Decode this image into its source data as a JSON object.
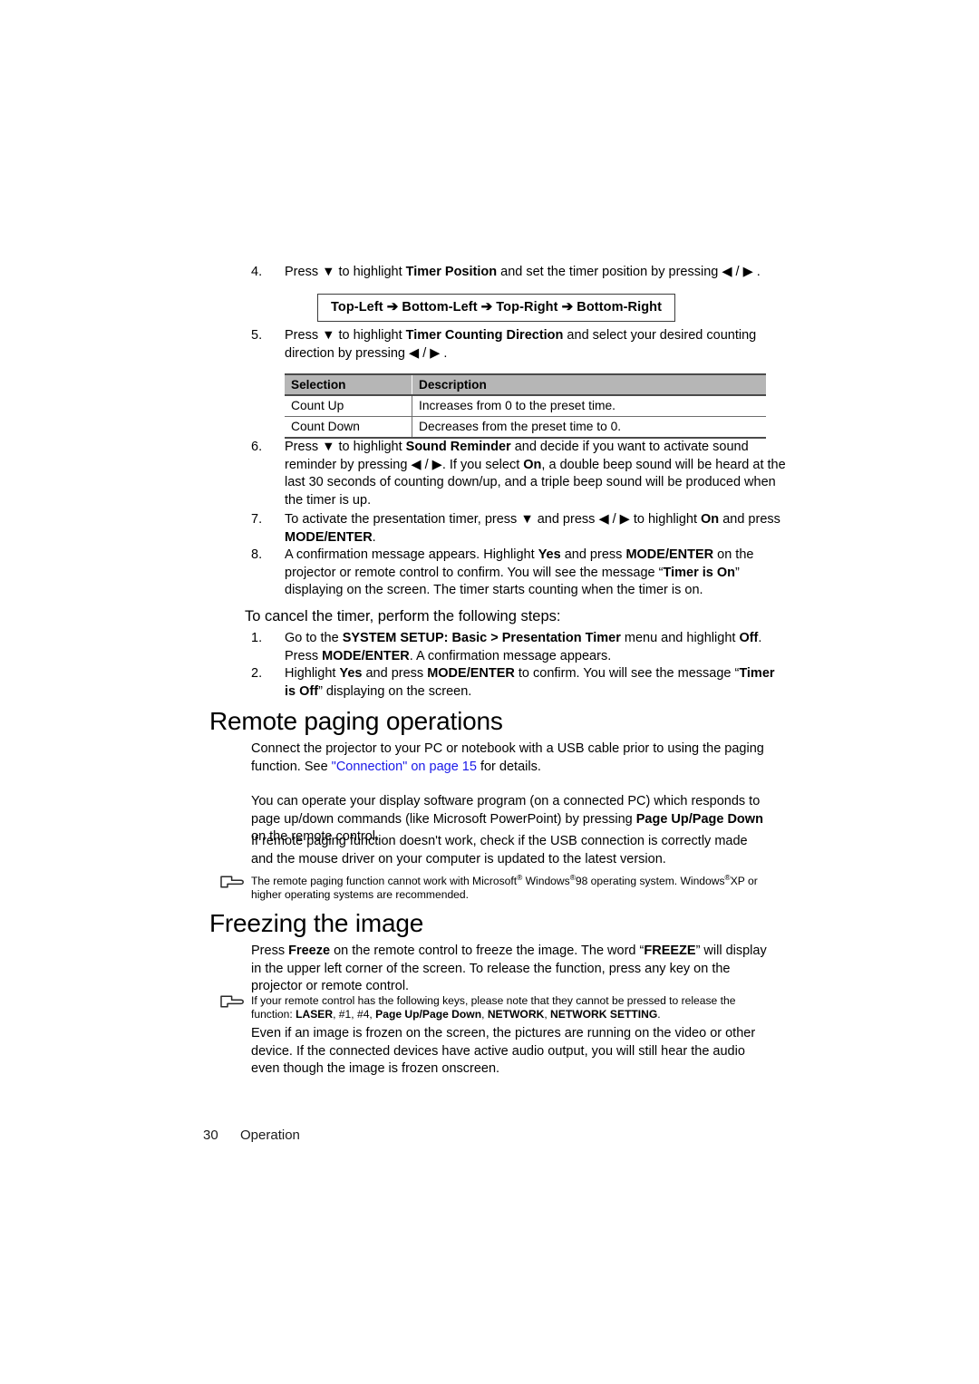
{
  "document": {
    "page_number": "30",
    "footer_label": "Operation",
    "link_color": "#1a19e8",
    "table_header_bg": "#b6b6b6"
  },
  "steps_top": [
    {
      "num": "4.",
      "parts": [
        {
          "t": "Press ",
          "s": "n"
        },
        {
          "t": "▼",
          "s": "n"
        },
        {
          "t": " to highlight ",
          "s": "n"
        },
        {
          "t": "Timer Position",
          "s": "b"
        },
        {
          "t": " and set the timer position by pressing ",
          "s": "n"
        },
        {
          "t": "◀ / ▶",
          "s": "n"
        },
        {
          "t": " .",
          "s": "n"
        }
      ]
    }
  ],
  "position_box": {
    "items": [
      "Top-Left",
      "Bottom-Left",
      "Top-Right",
      "Bottom-Right"
    ],
    "separator": "➔"
  },
  "step5": {
    "num": "5.",
    "parts": [
      {
        "t": "Press ",
        "s": "n"
      },
      {
        "t": "▼",
        "s": "n"
      },
      {
        "t": " to highlight ",
        "s": "n"
      },
      {
        "t": "Timer Counting Direction",
        "s": "b"
      },
      {
        "t": " and select your desired counting direction by pressing ",
        "s": "n"
      },
      {
        "t": "◀ / ▶",
        "s": "n"
      },
      {
        "t": " .",
        "s": "n"
      }
    ]
  },
  "selection_table": {
    "headers": [
      "Selection",
      "Description"
    ],
    "rows": [
      [
        "Count Up",
        "Increases from 0 to the preset time."
      ],
      [
        "Count Down",
        "Decreases from the preset time to 0."
      ]
    ]
  },
  "step6": {
    "num": "6.",
    "parts": [
      {
        "t": "Press ",
        "s": "n"
      },
      {
        "t": "▼",
        "s": "n"
      },
      {
        "t": " to highlight ",
        "s": "n"
      },
      {
        "t": "Sound Reminder",
        "s": "b"
      },
      {
        "t": " and decide if you want to activate sound reminder by pressing ",
        "s": "n"
      },
      {
        "t": "◀ / ▶",
        "s": "n"
      },
      {
        "t": ". If you select ",
        "s": "n"
      },
      {
        "t": "On",
        "s": "b"
      },
      {
        "t": ", a double beep sound will be heard at the last 30 seconds of counting down/up, and a triple beep sound will be produced when the timer is up.",
        "s": "n"
      }
    ]
  },
  "step7": {
    "num": "7.",
    "parts": [
      {
        "t": "To activate the presentation timer, press ",
        "s": "n"
      },
      {
        "t": "▼",
        "s": "n"
      },
      {
        "t": " and press ",
        "s": "n"
      },
      {
        "t": "◀ / ▶",
        "s": "n"
      },
      {
        "t": " to highlight ",
        "s": "n"
      },
      {
        "t": "On",
        "s": "b"
      },
      {
        "t": " and press ",
        "s": "n"
      },
      {
        "t": "MODE/ENTER",
        "s": "b"
      },
      {
        "t": ".",
        "s": "n"
      }
    ]
  },
  "step8": {
    "num": "8.",
    "parts": [
      {
        "t": "A confirmation message appears. Highlight ",
        "s": "n"
      },
      {
        "t": "Yes",
        "s": "b"
      },
      {
        "t": " and press ",
        "s": "n"
      },
      {
        "t": "MODE/ENTER",
        "s": "b"
      },
      {
        "t": " on the projector or remote control to confirm. You will see the message “",
        "s": "n"
      },
      {
        "t": "Timer is On",
        "s": "b"
      },
      {
        "t": "” displaying on the screen. The timer starts counting when the timer is on.",
        "s": "n"
      }
    ]
  },
  "cancel_heading": "To cancel the timer, perform the following steps:",
  "cancel_steps": [
    {
      "num": "1.",
      "parts": [
        {
          "t": "Go to the ",
          "s": "n"
        },
        {
          "t": "SYSTEM SETUP: Basic > Presentation Timer",
          "s": "b"
        },
        {
          "t": " menu and highlight ",
          "s": "n"
        },
        {
          "t": "Off",
          "s": "b"
        },
        {
          "t": ". Press ",
          "s": "n"
        },
        {
          "t": "MODE/ENTER",
          "s": "b"
        },
        {
          "t": ". A confirmation message appears.",
          "s": "n"
        }
      ]
    },
    {
      "num": "2.",
      "parts": [
        {
          "t": "Highlight ",
          "s": "n"
        },
        {
          "t": "Yes",
          "s": "b"
        },
        {
          "t": " and press ",
          "s": "n"
        },
        {
          "t": "MODE/ENTER",
          "s": "b"
        },
        {
          "t": " to confirm. You will see the message “",
          "s": "n"
        },
        {
          "t": "Timer is Off",
          "s": "b"
        },
        {
          "t": "” displaying on the screen.",
          "s": "n"
        }
      ]
    }
  ],
  "section_remote_paging": {
    "title": "Remote paging operations",
    "para1": [
      {
        "t": "Connect the projector to your PC or notebook with a USB cable prior to using the paging function. See ",
        "s": "n"
      },
      {
        "t": "\"Connection\" on page 15",
        "s": "link"
      },
      {
        "t": " for details.",
        "s": "n"
      }
    ],
    "para2": [
      {
        "t": "You can operate your display software program (on a connected PC) which responds to page up/down commands (like Microsoft PowerPoint) by pressing ",
        "s": "n"
      },
      {
        "t": "Page Up/Page Down",
        "s": "b"
      },
      {
        "t": " on the remote control.",
        "s": "n"
      }
    ],
    "para3": [
      {
        "t": "If remote paging function doesn't work, check if the USB connection is correctly made and the mouse driver on your computer is updated to the latest version.",
        "s": "n"
      }
    ],
    "note": [
      {
        "t": "The remote paging function cannot work with Microsoft",
        "s": "n"
      },
      {
        "t": "®",
        "s": "sup"
      },
      {
        "t": " Windows",
        "s": "n"
      },
      {
        "t": "®",
        "s": "sup"
      },
      {
        "t": "98 operating system. Windows",
        "s": "n"
      },
      {
        "t": "®",
        "s": "sup"
      },
      {
        "t": "XP or higher operating systems are recommended.",
        "s": "n"
      }
    ]
  },
  "section_freezing": {
    "title": "Freezing the image",
    "para1": [
      {
        "t": "Press ",
        "s": "n"
      },
      {
        "t": "Freeze",
        "s": "b"
      },
      {
        "t": " on the remote control to freeze the image. The word “",
        "s": "n"
      },
      {
        "t": "FREEZE",
        "s": "b"
      },
      {
        "t": "” will display in the upper left corner of the screen. To release the function, press any key on the projector or remote control.",
        "s": "n"
      }
    ],
    "note": [
      {
        "t": "If your remote control has the following keys, please note that they cannot be pressed to release the function: ",
        "s": "n"
      },
      {
        "t": "LASER",
        "s": "b"
      },
      {
        "t": ", #1, #4, ",
        "s": "n"
      },
      {
        "t": "Page Up/Page Down",
        "s": "b"
      },
      {
        "t": ", ",
        "s": "n"
      },
      {
        "t": "NETWORK",
        "s": "b"
      },
      {
        "t": ", ",
        "s": "n"
      },
      {
        "t": "NETWORK SETTING",
        "s": "b"
      },
      {
        "t": ".",
        "s": "n"
      }
    ],
    "para2": [
      {
        "t": "Even if an image is frozen on the screen, the pictures are running on the video or other device. If the connected devices have active audio output, you will still hear the audio even though the image is frozen onscreen.",
        "s": "n"
      }
    ]
  }
}
